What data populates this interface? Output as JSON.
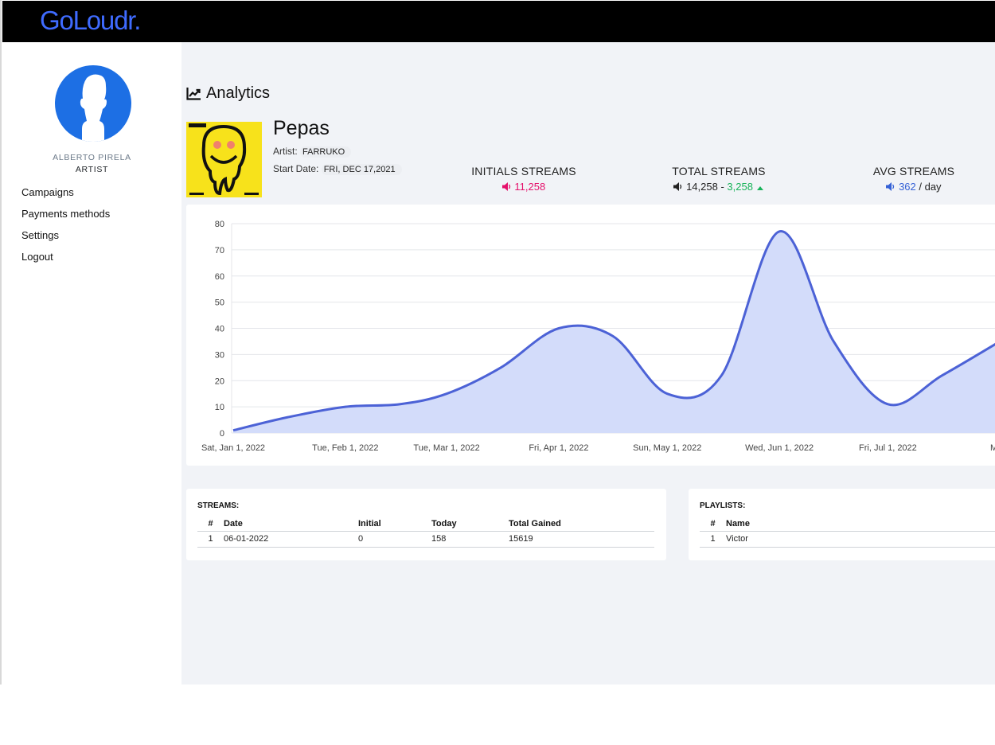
{
  "brand": {
    "logo": "GoLoudr."
  },
  "user": {
    "name": "ALBERTO PIRELA",
    "role": "ARTIST"
  },
  "nav": {
    "items": [
      {
        "label": "Campaigns"
      },
      {
        "label": "Payments methods"
      },
      {
        "label": "Settings"
      },
      {
        "label": "Logout"
      }
    ]
  },
  "page": {
    "title": "Analytics"
  },
  "track": {
    "title": "Pepas",
    "artist_label": "Artist:",
    "artist": "FARRUKO",
    "start_label": "Start Date:",
    "start_date": "FRI, DEC 17,2021"
  },
  "stats": {
    "initial": {
      "label": "INITIALS STREAMS",
      "value": "11,258"
    },
    "total": {
      "label": "TOTAL STREAMS",
      "value": "14,258",
      "sep": " - ",
      "gain": "3,258"
    },
    "avg": {
      "label": "AVG STREAMS",
      "value": "362",
      "suffix": " / day"
    }
  },
  "colors": {
    "accent": "#3f6bff",
    "pink": "#e5106b",
    "green": "#18b35a",
    "blue": "#3561d6",
    "line": "#4c62d6",
    "fill": "#d3dcfa"
  },
  "icons": {
    "title": "chart-line-icon",
    "speaker": "speaker-icon",
    "up": "caret-up-icon"
  },
  "chart_data": {
    "type": "area",
    "x_ticks": [
      "Sat, Jan 1, 2022",
      "Tue, Feb 1, 2022",
      "Tue, Mar 1, 2022",
      "Fri, Apr 1, 2022",
      "Sun, May 1, 2022",
      "Wed, Jun 1, 2022",
      "Fri, Jul 1, 2022",
      "Mon,"
    ],
    "y_ticks": [
      "0",
      "10",
      "20",
      "30",
      "40",
      "50",
      "60",
      "70",
      "80"
    ],
    "ylim": [
      0,
      80
    ],
    "grid": true,
    "x": [
      "2022-01-01",
      "2022-01-16",
      "2022-02-01",
      "2022-02-16",
      "2022-03-01",
      "2022-03-16",
      "2022-04-01",
      "2022-04-16",
      "2022-05-01",
      "2022-05-16",
      "2022-06-01",
      "2022-06-16",
      "2022-07-01",
      "2022-07-16",
      "2022-08-01"
    ],
    "values": [
      1,
      6,
      10,
      11,
      15,
      25,
      40,
      37,
      15,
      22,
      77,
      35,
      11,
      22,
      35
    ]
  },
  "streams": {
    "title": "STREAMS:",
    "columns": [
      "#",
      "Date",
      "Initial",
      "Today",
      "Total Gained"
    ],
    "rows": [
      [
        "1",
        "06-01-2022",
        "0",
        "158",
        "15619"
      ]
    ]
  },
  "playlists": {
    "title": "PLAYLISTS:",
    "columns": [
      "#",
      "Name"
    ],
    "rows": [
      [
        "1",
        "Victor"
      ]
    ]
  }
}
